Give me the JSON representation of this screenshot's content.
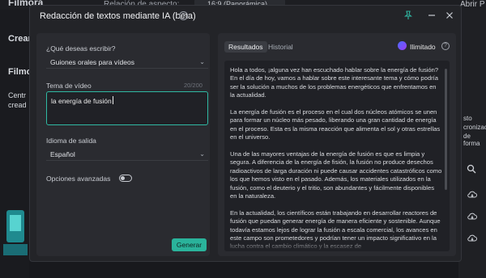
{
  "background": {
    "brand": "Filmora",
    "aspect_label": "Relación de aspecto:",
    "aspect_value": "16:9 (Panorámica)",
    "open_label": "Abrir P",
    "sidebar_items": [
      "Crear",
      "Filmo",
      "Centr",
      "cread"
    ],
    "right_text_1": "sto",
    "right_text_2": "cronizac",
    "right_text_3": "de forma"
  },
  "dialog": {
    "title": "Redacción de textos mediante IA (beta)",
    "help": "?"
  },
  "form": {
    "write_label": "¿Qué deseas escribir?",
    "write_value": "Guiones orales para vídeos",
    "topic_label": "Tema de vídeo",
    "topic_counter": "20/200",
    "topic_value": "la energía de fusión",
    "language_label": "Idioma de salida",
    "language_value": "Español",
    "advanced_label": "Opciones avanzadas",
    "advanced_enabled": false,
    "generate_label": "Generar"
  },
  "results": {
    "tabs": [
      "Resultados",
      "Historial"
    ],
    "active_tab": "Resultados",
    "plan_label": "Ilimitado",
    "paragraphs": [
      "Hola a todos, ¡alguna vez han escuchado hablar sobre la energía de fusión? En el día de hoy, vamos a hablar sobre este interesante tema y cómo podría ser la solución a muchos de los problemas energéticos que enfrentamos en la actualidad.",
      "La energía de fusión es el proceso en el cual dos núcleos atómicos se unen para formar un núcleo más pesado, liberando una gran cantidad de energía en el proceso. Esta es la misma reacción que alimenta el sol y otras estrellas en el universo.",
      "Una de las mayores ventajas de la energía de fusión es que es limpia y segura. A diferencia de la energía de fisión, la fusión no produce desechos radioactivos de larga duración ni puede causar accidentes catastróficos como los que hemos visto en el pasado. Además, los materiales utilizados en la fusión, como el deuterio y el tritio, son abundantes y fácilmente disponibles en la naturaleza.",
      "En la actualidad, los científicos están trabajando en desarrollar reactores de fusión que puedan generar energía de manera eficiente y sostenible. Aunque todavía estamos lejos de lograr la fusión a escala comercial, los avances en este campo son prometedores y podrían tener un impacto significativo en la lucha contra el cambio climático y la escasez de"
    ]
  },
  "colors": {
    "accent": "#2ab39b",
    "dialog_bg": "#232428",
    "panel_bg": "#2a2b30"
  }
}
